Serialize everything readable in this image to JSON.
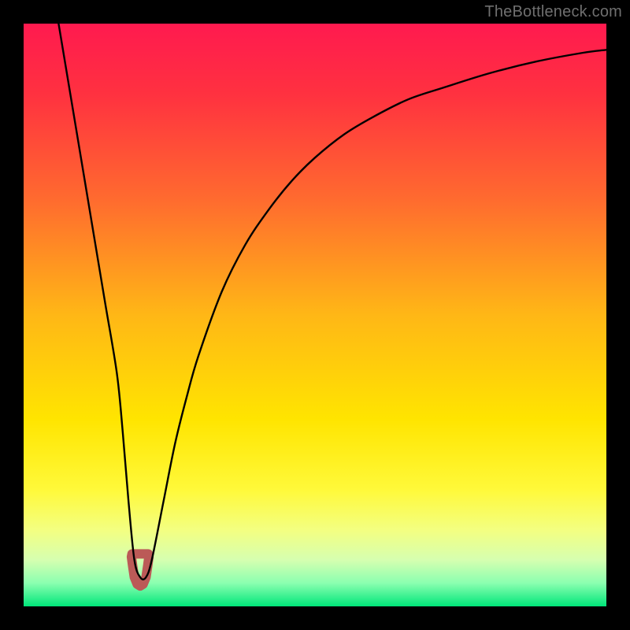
{
  "watermark": "TheBottleneck.com",
  "chart_data": {
    "type": "line",
    "title": "",
    "xlabel": "",
    "ylabel": "",
    "xlim": [
      0,
      100
    ],
    "ylim": [
      0,
      100
    ],
    "grid": false,
    "legend": null,
    "series": [
      {
        "name": "bottleneck-curve",
        "color": "#000000",
        "x": [
          6,
          8,
          10,
          12,
          14,
          16,
          17,
          18,
          19,
          20,
          21,
          22,
          24,
          26,
          28,
          30,
          34,
          38,
          42,
          46,
          50,
          55,
          60,
          66,
          72,
          80,
          88,
          96,
          100
        ],
        "y": [
          100,
          88,
          76,
          64,
          52,
          40,
          30,
          18,
          8,
          5,
          5,
          8,
          18,
          28,
          36,
          43,
          54,
          62,
          68,
          73,
          77,
          81,
          84,
          87,
          89,
          91.5,
          93.5,
          95,
          95.5
        ]
      },
      {
        "name": "bottleneck-valley-marker",
        "color": "#bb5a57",
        "x": [
          18.7,
          19.0,
          19.5,
          20.0,
          20.5,
          21.0,
          21.3,
          21.5,
          21.4,
          21.0,
          20.5,
          20.0,
          19.5,
          19.0,
          18.6,
          18.5,
          18.7
        ],
        "y": [
          7.0,
          5.0,
          3.8,
          3.5,
          3.8,
          5.0,
          7.0,
          8.5,
          9.0,
          9.0,
          9.0,
          9.0,
          9.0,
          9.0,
          9.0,
          8.5,
          7.0
        ]
      }
    ],
    "gradient_stops": [
      {
        "offset": 0.0,
        "color": "#ff1a4f"
      },
      {
        "offset": 0.12,
        "color": "#ff3140"
      },
      {
        "offset": 0.3,
        "color": "#ff6a2f"
      },
      {
        "offset": 0.5,
        "color": "#ffb716"
      },
      {
        "offset": 0.68,
        "color": "#ffe500"
      },
      {
        "offset": 0.8,
        "color": "#fff93a"
      },
      {
        "offset": 0.87,
        "color": "#f3ff82"
      },
      {
        "offset": 0.92,
        "color": "#d6ffb0"
      },
      {
        "offset": 0.96,
        "color": "#8bffb0"
      },
      {
        "offset": 1.0,
        "color": "#00e67a"
      }
    ]
  }
}
